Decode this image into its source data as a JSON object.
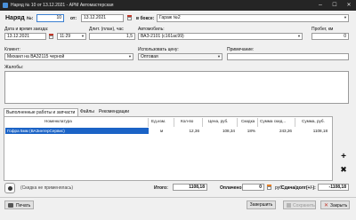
{
  "window": {
    "title": "Наряд № 10 от 13.12.2021 - АРМ Автомастерская",
    "minimize": "–",
    "maximize": "☐",
    "close": "✕"
  },
  "header": {
    "order_label": "Наряд",
    "number_label": "№:",
    "number_value": "10",
    "date_label": "от:",
    "date_value": "13.12.2021",
    "box_label": "в боксе:",
    "box_value": "Гараж №2"
  },
  "times": {
    "datetime_label": "Дата и время заезда:",
    "date_value": "13.12.2021",
    "time_value": "11:29",
    "duration_label": "Длит. (план), час",
    "duration_value": "1,5",
    "car_label": "Автомобиль:",
    "car_value": "ВАЗ-2101 (с161ас99)",
    "mileage_label": "Пробег, км",
    "mileage_value": "0"
  },
  "client": {
    "client_label": "Клиент:",
    "client_value": "Михаил на ВАЗ2115 черной",
    "price_label": "Использовать цену:",
    "price_value": "Оптовая",
    "note_label": "Примечание:",
    "note_value": "",
    "complaints_label": "Жалобы:",
    "complaints_value": ""
  },
  "tabs": {
    "works": "Выполненные работы и запчасти",
    "files": "Файлы",
    "recommendations": "Рекомендации"
  },
  "table": {
    "headers": [
      "Номенклатура",
      "Ед.изм.",
      "Кол-во",
      "Цена, руб.",
      "Скидка",
      "Сумма скид...",
      "Сумма, руб."
    ],
    "rows": [
      {
        "name": "Гофра 5мм (ВАЗинтерСервис)",
        "unit": "м",
        "qty": "12,36",
        "price": "108,34",
        "discount": "18%",
        "discount_sum": "243,26",
        "sum": "1108,18"
      }
    ]
  },
  "side_buttons": {
    "add": "+",
    "delete": "✖"
  },
  "summary": {
    "discount_note": "(Скидка не применялась)",
    "total_label": "Итого:",
    "total_value": "1108,18",
    "paid_label": "Оплачено:",
    "paid_value": "0",
    "paid_unit": "руб.",
    "debt_label": "Сдача/долг(+/-):",
    "debt_value": "-1108,18"
  },
  "footer": {
    "print_label": "Печать",
    "finish_label": "Завершить",
    "save_label": "Сохранить",
    "close_label": "Закрыть"
  }
}
